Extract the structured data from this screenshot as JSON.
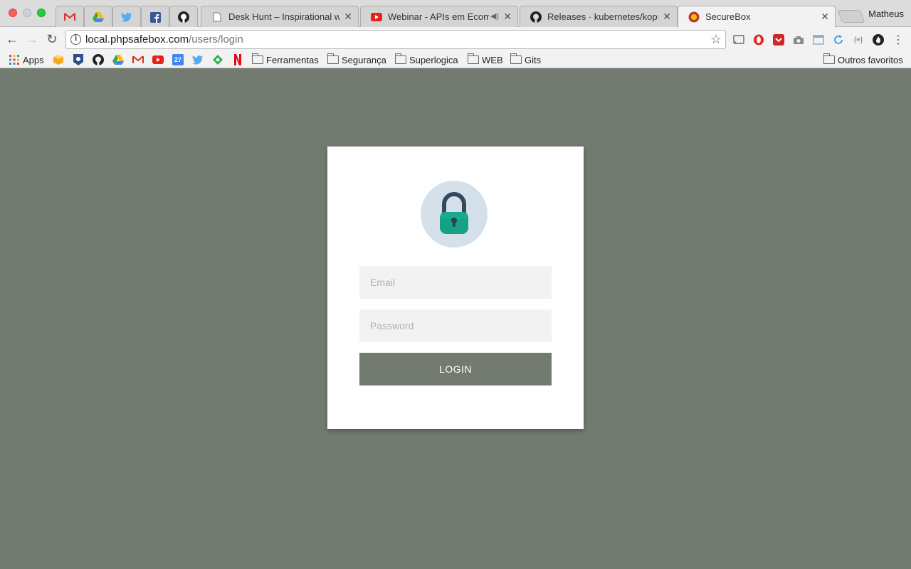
{
  "browser": {
    "profile_name": "Matheus",
    "tabs": [
      {
        "title": "",
        "icon": "gmail-icon",
        "pinned": true
      },
      {
        "title": "",
        "icon": "google-drive-icon",
        "pinned": true
      },
      {
        "title": "",
        "icon": "twitter-icon",
        "pinned": true
      },
      {
        "title": "",
        "icon": "facebook-icon",
        "pinned": true
      },
      {
        "title": "",
        "icon": "github-icon",
        "pinned": true
      },
      {
        "title": "Desk Hunt – Inspirational work",
        "icon": "document-icon"
      },
      {
        "title": "Webinar - APIs em Ecomme",
        "icon": "youtube-icon",
        "audio": "speaker-icon"
      },
      {
        "title": "Releases · kubernetes/kops",
        "icon": "github-icon"
      },
      {
        "title": "SecureBox",
        "icon": "securebox-icon",
        "active": true
      }
    ],
    "address": {
      "host": "local.phpsafebox.com",
      "path": "/users/login"
    },
    "bookmarks": [
      {
        "label": "Apps",
        "icon": "apps-grid-icon"
      },
      {
        "label": "",
        "icon": "box-icon"
      },
      {
        "label": "",
        "icon": "badge-icon"
      },
      {
        "label": "",
        "icon": "github-icon"
      },
      {
        "label": "",
        "icon": "google-drive-icon"
      },
      {
        "label": "",
        "icon": "gmail-icon"
      },
      {
        "label": "",
        "icon": "youtube-icon"
      },
      {
        "label": "",
        "icon": "calendar-icon",
        "text": "27"
      },
      {
        "label": "",
        "icon": "twitter-icon"
      },
      {
        "label": "",
        "icon": "feedly-icon"
      },
      {
        "label": "",
        "icon": "netflix-icon"
      },
      {
        "label": "Ferramentas",
        "icon": "folder-icon"
      },
      {
        "label": "Segurança",
        "icon": "folder-icon"
      },
      {
        "label": "Superlogica",
        "icon": "folder-icon"
      },
      {
        "label": "WEB",
        "icon": "folder-icon"
      },
      {
        "label": "Gits",
        "icon": "folder-icon"
      }
    ],
    "other_bookmarks": "Outros favoritos",
    "extensions": [
      "cast-icon",
      "opera-icon",
      "pocket-icon",
      "camera-icon",
      "window-icon",
      "refresh-icon",
      "json-icon",
      "fire-icon",
      "more-icon"
    ]
  },
  "login": {
    "email_placeholder": "Email",
    "password_placeholder": "Password",
    "button_label": "LOGIN"
  },
  "colors": {
    "page_background": "#737b70",
    "lock_badge": "#d4e1ea",
    "lock_body": "#16a085",
    "lock_shackle": "#34495e",
    "button": "#737b70"
  }
}
